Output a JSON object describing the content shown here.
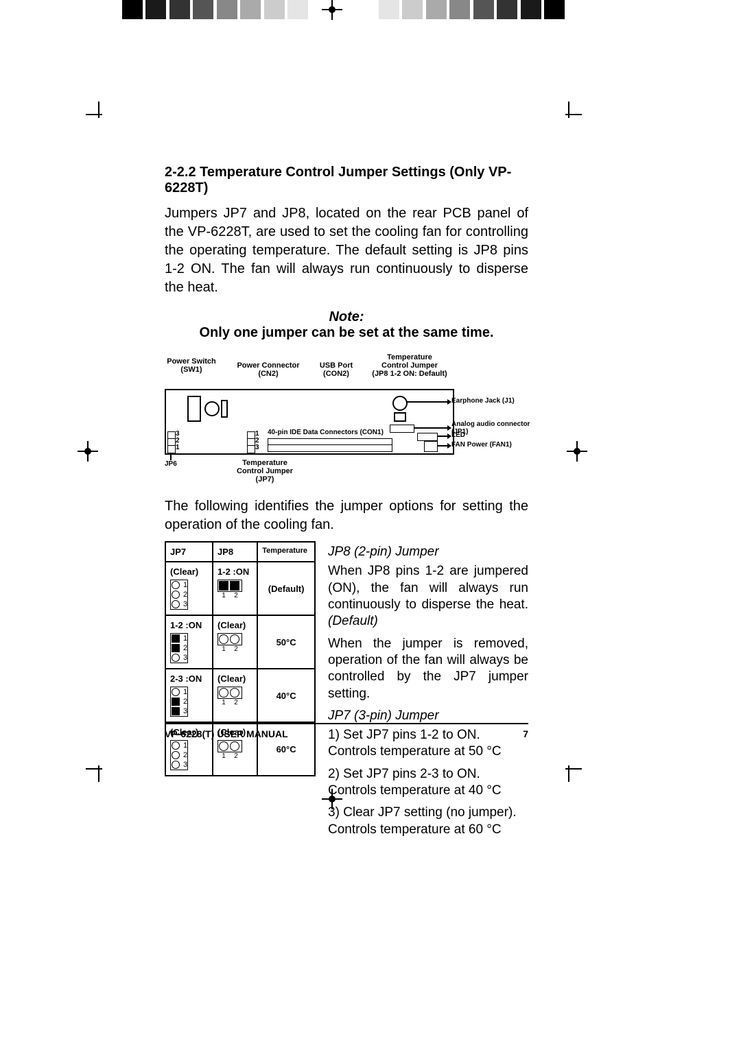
{
  "section_heading": "2-2.2 Temperature Control Jumper Settings (Only VP-6228T)",
  "intro_paragraph": "Jumpers JP7 and JP8, located on the rear PCB panel of the VP-6228T, are used to set the cooling fan for controlling the operating temperature. The default setting is JP8 pins 1-2 ON. The fan will always run continuously to disperse the heat.",
  "note_label": "Note:",
  "note_text": "Only one jumper can be set at the same time.",
  "after_diagram_paragraph": "The following identifies the jumper options for setting the operation of the cooling fan.",
  "diagram": {
    "power_switch": "Power Switch\n(SW1)",
    "power_connector": "Power Connector\n(CN2)",
    "usb_port": "USB Port\n(CON2)",
    "temp_jumper": "Temperature\nControl Jumper\n(JP8 1-2 ON: Default)",
    "earphone": "Earphone Jack (J1)",
    "analog_audio": "Analog audio connector\n(JP1)",
    "led": "LED",
    "fan_power": "FAN Power (FAN1)",
    "ide": "40-pin IDE Data Connectors (CON1)",
    "jp6": "JP6",
    "jp7_label": "Temperature\nControl Jumper\n(JP7)",
    "pins_321": {
      "p1": "1",
      "p2": "2",
      "p3": "3"
    }
  },
  "table": {
    "headers": {
      "jp7": "JP7",
      "jp8": "JP8",
      "temp": "Temperature"
    },
    "rows": [
      {
        "jp7_state": "(Clear)",
        "jp7_pins": [
          "open",
          "open",
          "open"
        ],
        "jp8_state": "1-2 :ON",
        "jp8_pins": [
          "closed",
          "closed"
        ],
        "temp": "(Default)"
      },
      {
        "jp7_state": "1-2 :ON",
        "jp7_pins": [
          "closed",
          "closed",
          "open"
        ],
        "jp8_state": "(Clear)",
        "jp8_pins": [
          "open",
          "open"
        ],
        "temp": "50°C"
      },
      {
        "jp7_state": "2-3 :ON",
        "jp7_pins": [
          "open",
          "closed",
          "closed"
        ],
        "jp8_state": "(Clear)",
        "jp8_pins": [
          "open",
          "open"
        ],
        "temp": "40°C"
      },
      {
        "jp7_state": "(Clear)",
        "jp7_pins": [
          "open",
          "open",
          "open"
        ],
        "jp8_state": "(Clear)",
        "jp8_pins": [
          "open",
          "open"
        ],
        "temp": "60°C"
      }
    ],
    "pin_labels": {
      "p1": "1",
      "p2": "2",
      "p3": "3"
    }
  },
  "jp8_section": {
    "heading": "JP8 (2-pin) Jumper",
    "para1a": "When JP8 pins 1-2 are jumpered (ON), the fan will always run continuously to disperse the heat. ",
    "para1_default": "(Default)",
    "para2": "When the jumper is removed, operation of the fan will always be controlled by the JP7 jumper setting."
  },
  "jp7_section": {
    "heading": "JP7 (3-pin) Jumper",
    "item1a": "1)  Set JP7 pins 1-2 to ON.",
    "item1b": "Controls temperature at 50 °C",
    "item2a": "2)  Set JP7 pins 2-3 to ON.",
    "item2b": "Controls temperature at 40 °C",
    "item3a": "3)  Clear JP7 setting (no jumper).",
    "item3b": "Controls temperature at 60 °C"
  },
  "footer": {
    "left": "VP-6228(T) USER MANUAL",
    "right": "7"
  }
}
